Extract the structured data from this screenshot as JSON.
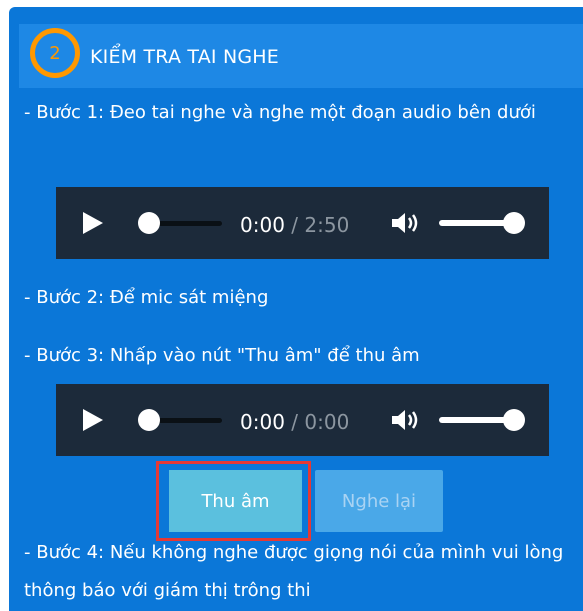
{
  "section": {
    "number": "2",
    "title": "KIỂM TRA TAI NGHE"
  },
  "steps": {
    "step1": "- Bước 1: Đeo tai nghe và nghe một đoạn audio bên dưới",
    "step2": "- Bước 2: Để mic sát miệng",
    "step3": "- Bước 3: Nhấp vào nút \"Thu âm\" để thu âm",
    "step4": "- Bước 4: Nếu không nghe được giọng nói của mình vui lòng thông báo với giám thị trông thi"
  },
  "player1": {
    "current_time": "0:00",
    "separator": " / ",
    "duration": "2:50",
    "volume_level": 1.0
  },
  "player2": {
    "current_time": "0:00",
    "separator": " / ",
    "duration": "0:00",
    "volume_level": 1.0
  },
  "buttons": {
    "record_label": "Thu âm",
    "replay_label": "Nghe lại"
  },
  "colors": {
    "panel_bg": "#0b77d8",
    "header_bg": "#1e88e5",
    "accent_orange": "#ff9800",
    "player_bg": "#1c2a3a",
    "record_button": "#5bc0de",
    "highlight_border": "#e53935"
  },
  "icons": {
    "play": "play-icon",
    "volume": "volume-icon"
  }
}
